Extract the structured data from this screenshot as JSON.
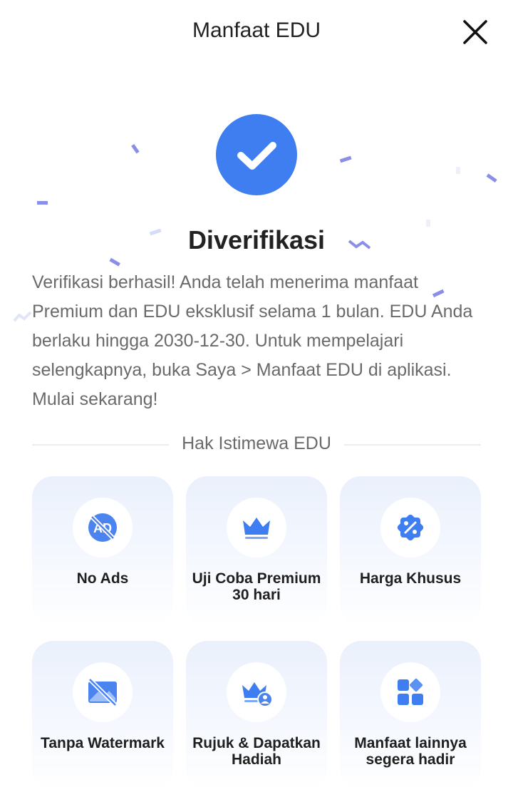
{
  "header": {
    "title": "Manfaat EDU",
    "close_icon": "close-icon"
  },
  "status": {
    "icon": "checkmark-icon",
    "title": "Diverifikasi",
    "message": "Verifikasi berhasil! Anda telah menerima manfaat Premium dan EDU eksklusif selama 1 bulan. EDU Anda berlaku hingga 2030-12-30. Untuk mempelajari selengkapnya, buka Saya > Manfaat EDU di aplikasi. Mulai sekarang!"
  },
  "privileges": {
    "heading": "Hak Istimewa EDU",
    "items": [
      {
        "label": "No Ads",
        "icon": "no-ads-icon"
      },
      {
        "label": "Uji Coba Premium 30 hari",
        "icon": "crown-icon"
      },
      {
        "label": "Harga Khusus",
        "icon": "discount-badge-icon"
      },
      {
        "label": "Tanpa Watermark",
        "icon": "no-watermark-icon"
      },
      {
        "label": "Rujuk & Dapatkan Hadiah",
        "icon": "crown-user-icon"
      },
      {
        "label": "Manfaat lainnya segera hadir",
        "icon": "more-apps-icon"
      }
    ]
  },
  "colors": {
    "accent": "#3f7ef0",
    "icon_light": "#7aa7f7",
    "confetti": "#8a8ee6",
    "text_primary": "#222222",
    "text_secondary": "#6a6a6a",
    "card_gradient_top": "#eaf0fc"
  }
}
